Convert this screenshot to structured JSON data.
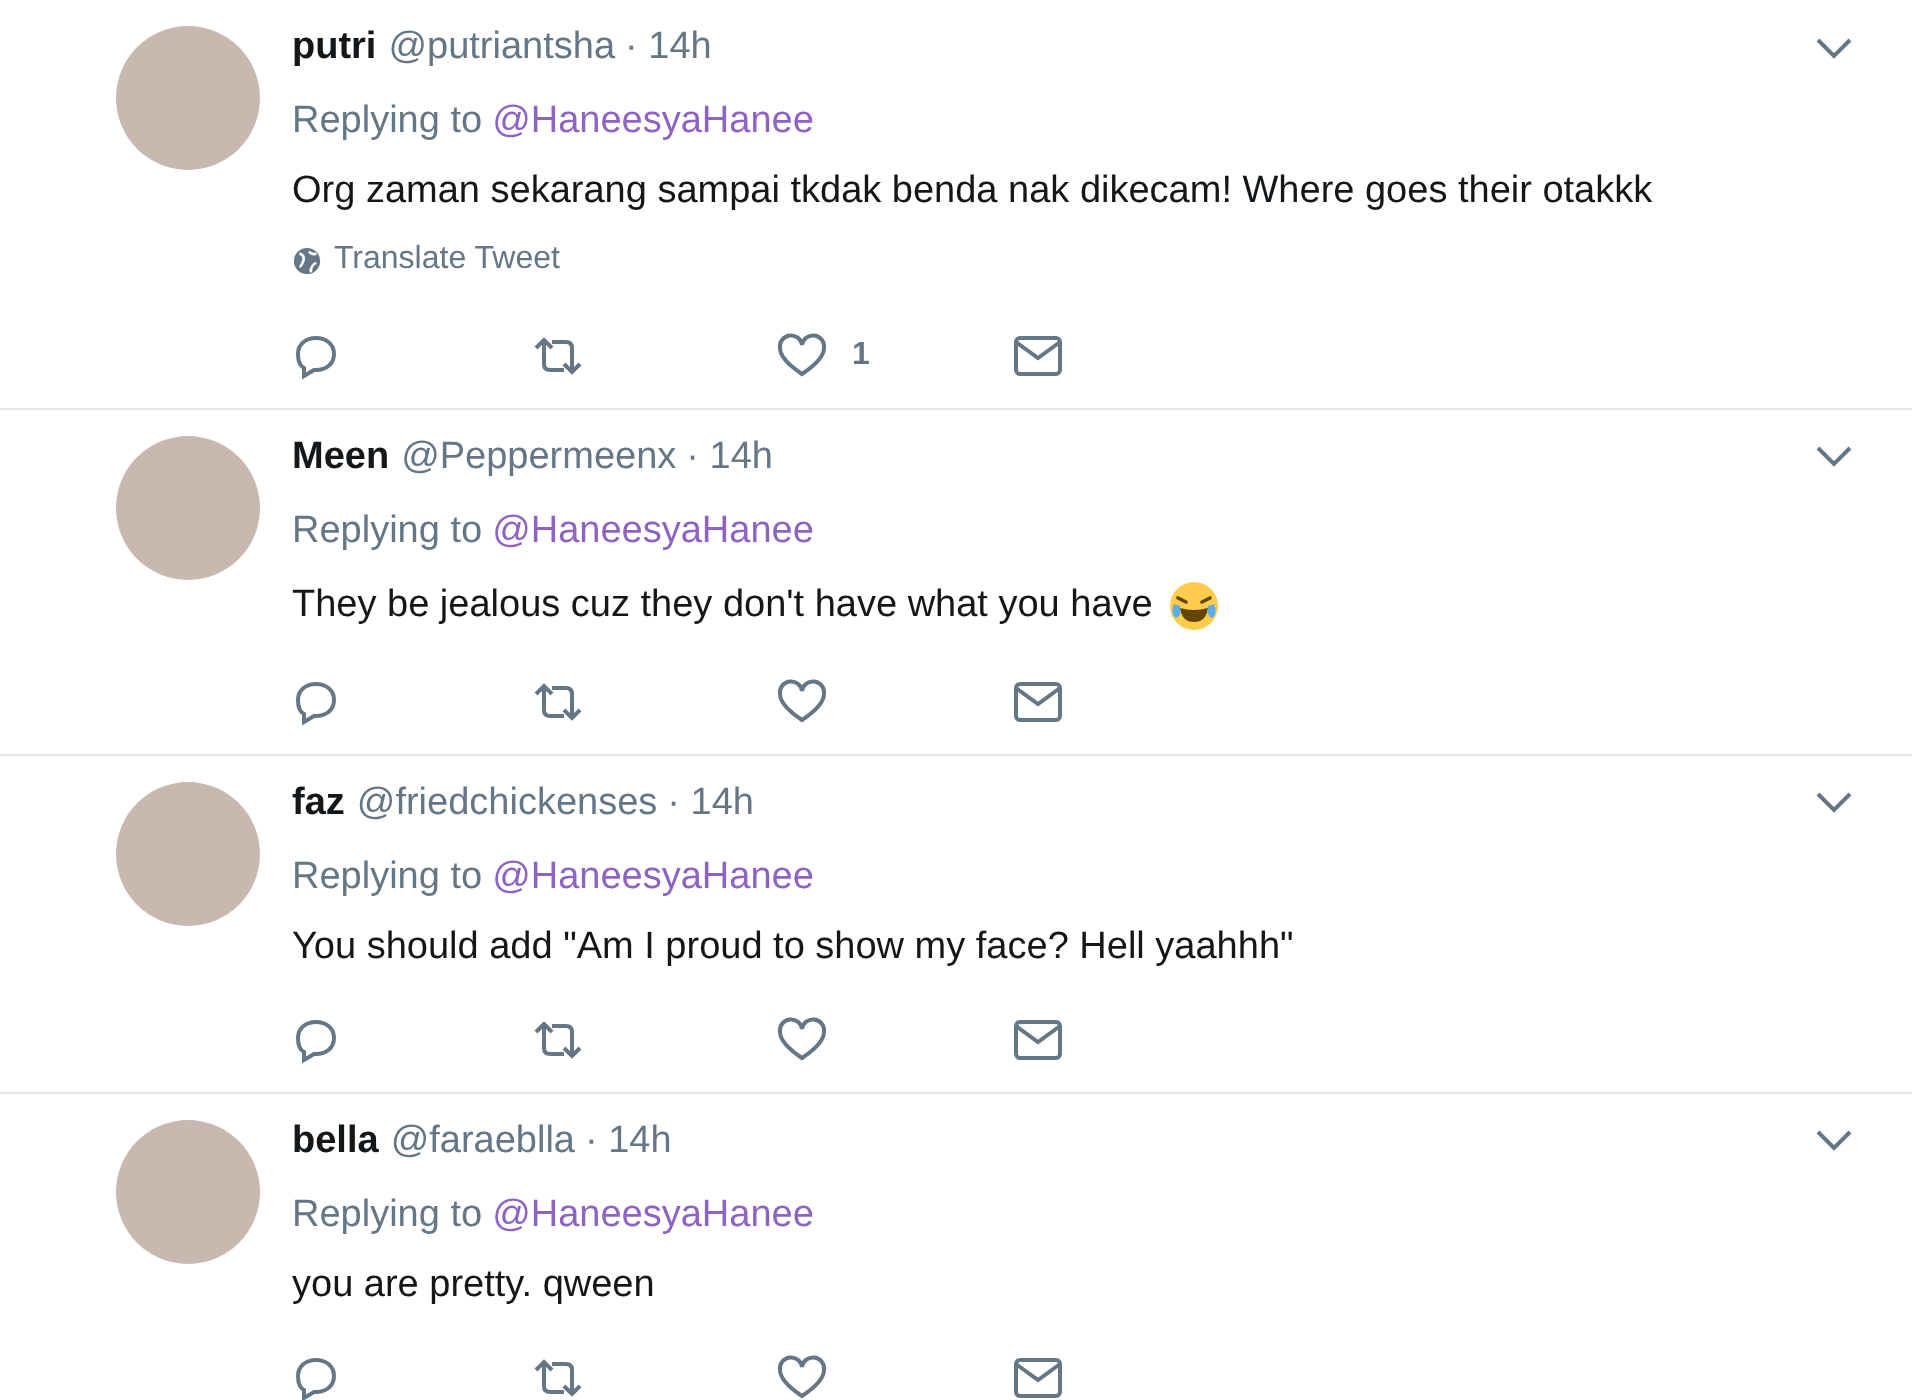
{
  "tweets": [
    {
      "name": "putri",
      "handle": "@putriantsha",
      "time": "· 14h",
      "replying_label": "Replying to",
      "replying_to": "@HaneesyaHanee",
      "text": "Org zaman sekarang sampai tkdak benda nak dikecam! Where goes their otakkk",
      "emoji": false,
      "translate": "Translate Tweet",
      "likes": "1"
    },
    {
      "name": "Meen",
      "handle": "@Peppermeenx",
      "time": "· 14h",
      "replying_label": "Replying to",
      "replying_to": "@HaneesyaHanee",
      "text": "They be jealous cuz they don't have what you have",
      "emoji": true
    },
    {
      "name": "faz",
      "handle": "@friedchickenses",
      "time": "· 14h",
      "replying_label": "Replying to",
      "replying_to": "@HaneesyaHanee",
      "text": "You should add \"Am I proud to show my face? Hell yaahhh\"",
      "emoji": false
    },
    {
      "name": "bella",
      "handle": "@faraeblla",
      "time": "· 14h",
      "replying_label": "Replying to",
      "replying_to": "@HaneesyaHanee",
      "text": "you are pretty. qween",
      "emoji": false
    }
  ]
}
